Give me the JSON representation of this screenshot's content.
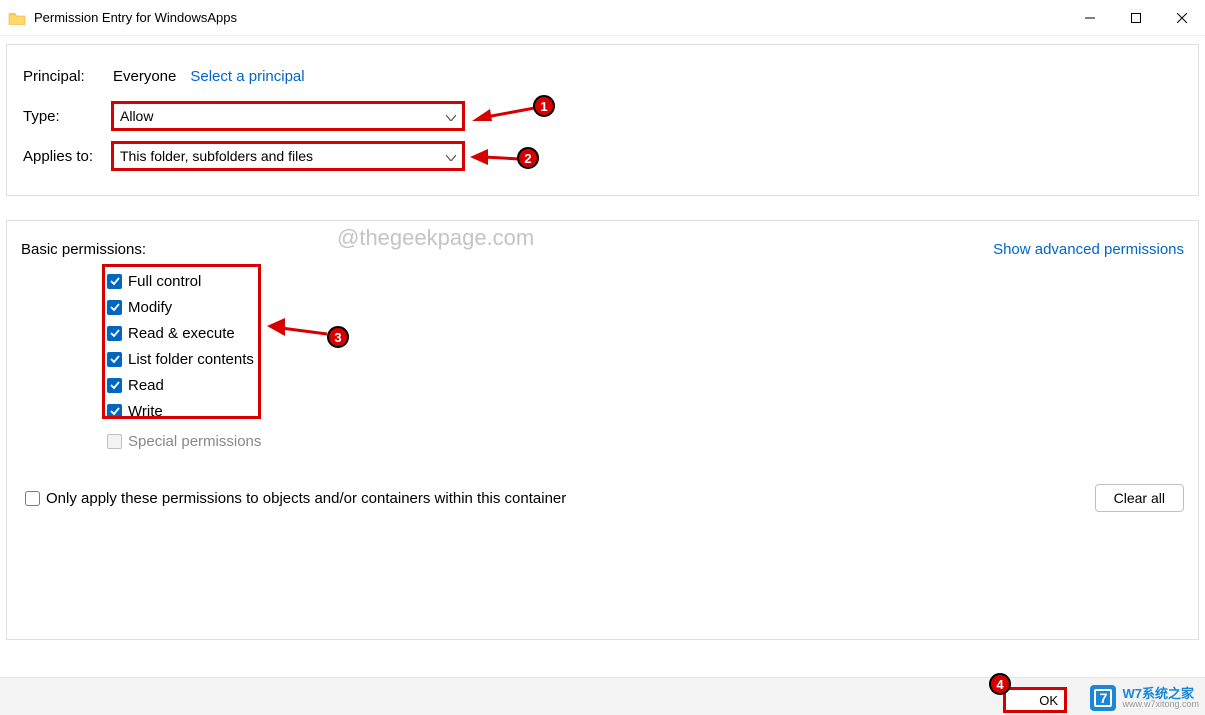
{
  "window": {
    "title": "Permission Entry for WindowsApps"
  },
  "principal": {
    "label": "Principal:",
    "value": "Everyone",
    "select_link": "Select a principal"
  },
  "type": {
    "label": "Type:",
    "value": "Allow"
  },
  "applies": {
    "label": "Applies to:",
    "value": "This folder, subfolders and files"
  },
  "perm": {
    "heading": "Basic permissions:",
    "advanced_link": "Show advanced permissions",
    "items": {
      "full_control": "Full control",
      "modify": "Modify",
      "read_execute": "Read & execute",
      "list_folder": "List folder contents",
      "read": "Read",
      "write": "Write",
      "special": "Special permissions"
    },
    "only_apply": "Only apply these permissions to objects and/or containers within this container",
    "clear_all": "Clear all"
  },
  "buttons": {
    "ok": "OK"
  },
  "annotations": {
    "one": "1",
    "two": "2",
    "three": "3",
    "four": "4"
  },
  "watermark": "@thegeekpage.com",
  "brand": {
    "name": "W7系统之家",
    "url": "www.w7xitong.com",
    "logo": "7"
  }
}
